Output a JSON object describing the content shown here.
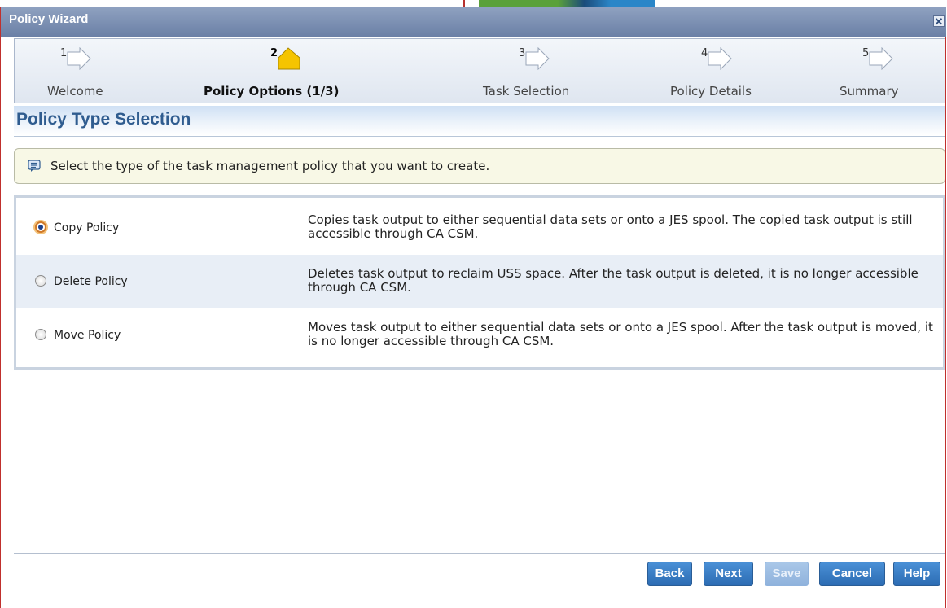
{
  "window": {
    "title": "Policy Wizard",
    "close_glyph": "✕"
  },
  "steps": [
    {
      "number": "1",
      "label": "Welcome",
      "active": false
    },
    {
      "number": "2",
      "label": "Policy Options (1/3)",
      "active": true
    },
    {
      "number": "3",
      "label": "Task Selection",
      "active": false
    },
    {
      "number": "4",
      "label": "Policy Details",
      "active": false
    },
    {
      "number": "5",
      "label": "Summary",
      "active": false
    }
  ],
  "section": {
    "title": "Policy Type Selection"
  },
  "info": {
    "icon": "message-icon",
    "text": "Select the type of the task management policy that you want to create."
  },
  "policy_types": [
    {
      "name": "Copy Policy",
      "selected": true,
      "description": "Copies task output to either sequential data sets or onto a JES spool. The copied task output is still accessible through CA CSM."
    },
    {
      "name": "Delete Policy",
      "selected": false,
      "description": "Deletes task output to reclaim USS space. After the task output is deleted, it is no longer accessible through CA CSM."
    },
    {
      "name": "Move Policy",
      "selected": false,
      "description": "Moves task output to either sequential data sets or onto a JES spool. After the task output is moved, it is no longer accessible through CA CSM."
    }
  ],
  "buttons": {
    "back": "Back",
    "next": "Next",
    "save": "Save",
    "cancel": "Cancel",
    "help": "Help"
  },
  "colors": {
    "title_bar": "#6b80a6",
    "active_step": "#f5c400",
    "button": "#2c6cb3",
    "section_title": "#2f5c8f"
  }
}
